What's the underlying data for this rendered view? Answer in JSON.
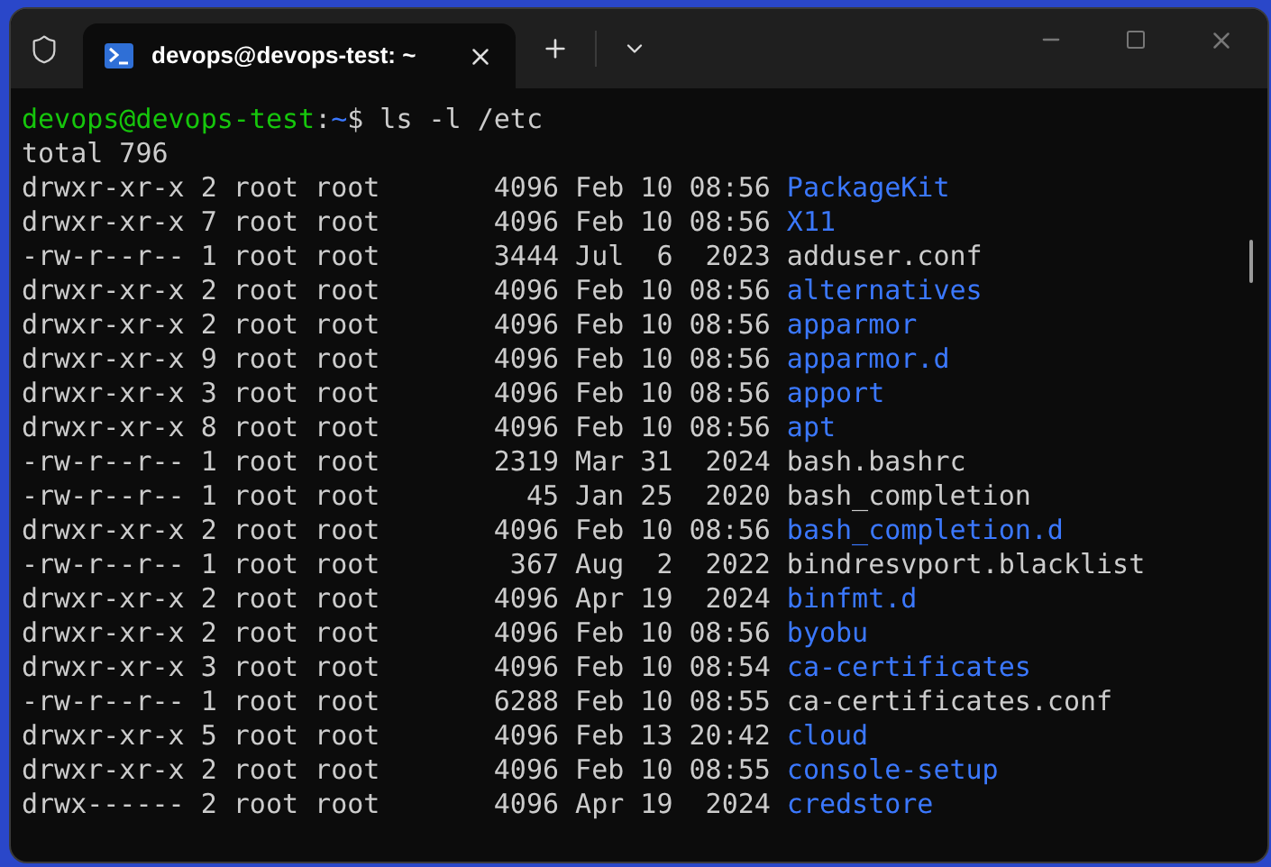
{
  "tabs": [
    {
      "label": "devops@devops-test: ~",
      "selected": true
    }
  ],
  "prompt": {
    "user_host": "devops@devops-test",
    "separator": ":",
    "path": "~",
    "command": "$ ls -l /etc"
  },
  "output_header": "total 796",
  "rows": [
    {
      "listing": "drwxr-xr-x 2 root root       4096 Feb 10 08:56",
      "name": "PackageKit",
      "kind": "dir"
    },
    {
      "listing": "drwxr-xr-x 7 root root       4096 Feb 10 08:56",
      "name": "X11",
      "kind": "dir"
    },
    {
      "listing": "-rw-r--r-- 1 root root       3444 Jul  6  2023",
      "name": "adduser.conf",
      "kind": "file"
    },
    {
      "listing": "drwxr-xr-x 2 root root       4096 Feb 10 08:56",
      "name": "alternatives",
      "kind": "dir"
    },
    {
      "listing": "drwxr-xr-x 2 root root       4096 Feb 10 08:56",
      "name": "apparmor",
      "kind": "dir"
    },
    {
      "listing": "drwxr-xr-x 9 root root       4096 Feb 10 08:56",
      "name": "apparmor.d",
      "kind": "dir"
    },
    {
      "listing": "drwxr-xr-x 3 root root       4096 Feb 10 08:56",
      "name": "apport",
      "kind": "dir"
    },
    {
      "listing": "drwxr-xr-x 8 root root       4096 Feb 10 08:56",
      "name": "apt",
      "kind": "dir"
    },
    {
      "listing": "-rw-r--r-- 1 root root       2319 Mar 31  2024",
      "name": "bash.bashrc",
      "kind": "file"
    },
    {
      "listing": "-rw-r--r-- 1 root root         45 Jan 25  2020",
      "name": "bash_completion",
      "kind": "file"
    },
    {
      "listing": "drwxr-xr-x 2 root root       4096 Feb 10 08:56",
      "name": "bash_completion.d",
      "kind": "dir"
    },
    {
      "listing": "-rw-r--r-- 1 root root        367 Aug  2  2022",
      "name": "bindresvport.blacklist",
      "kind": "file"
    },
    {
      "listing": "drwxr-xr-x 2 root root       4096 Apr 19  2024",
      "name": "binfmt.d",
      "kind": "dir"
    },
    {
      "listing": "drwxr-xr-x 2 root root       4096 Feb 10 08:56",
      "name": "byobu",
      "kind": "dir"
    },
    {
      "listing": "drwxr-xr-x 3 root root       4096 Feb 10 08:54",
      "name": "ca-certificates",
      "kind": "dir"
    },
    {
      "listing": "-rw-r--r-- 1 root root       6288 Feb 10 08:55",
      "name": "ca-certificates.conf",
      "kind": "file"
    },
    {
      "listing": "drwxr-xr-x 5 root root       4096 Feb 13 20:42",
      "name": "cloud",
      "kind": "dir"
    },
    {
      "listing": "drwxr-xr-x 2 root root       4096 Feb 10 08:55",
      "name": "console-setup",
      "kind": "dir"
    },
    {
      "listing": "drwx------ 2 root root       4096 Apr 19  2024",
      "name": "credstore",
      "kind": "dir"
    }
  ]
}
